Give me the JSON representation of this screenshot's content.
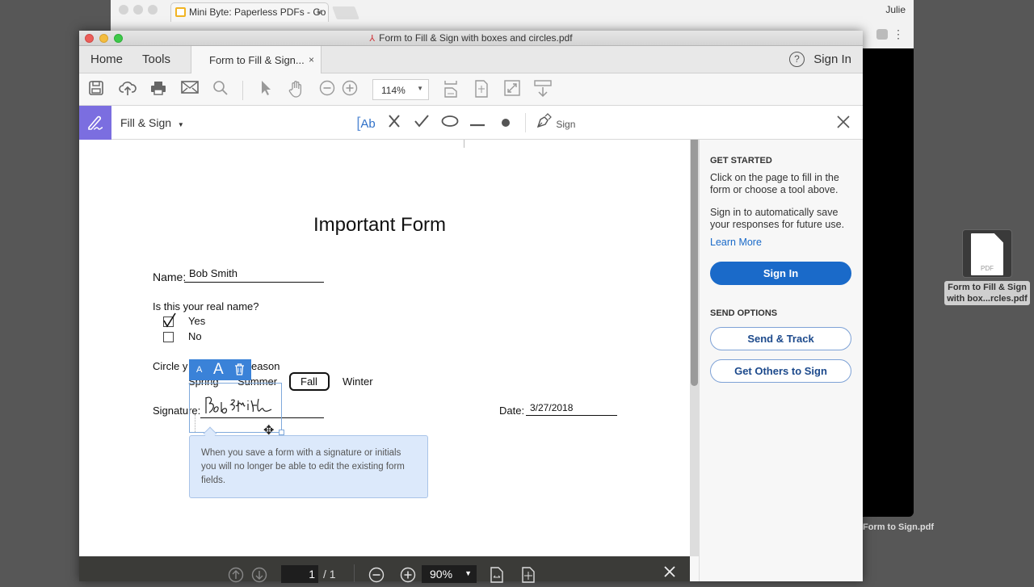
{
  "browser": {
    "tab_title": "Mini Byte: Paperless PDFs - Go",
    "user": "Julie"
  },
  "desktop": {
    "file1_tag": "PDF",
    "file1_label_line1": "Form to Fill & Sign",
    "file1_label_line2": "with box...rcles.pdf",
    "file2_label": "Form to Sign.pdf"
  },
  "window": {
    "title": "Form to Fill & Sign with boxes and circles.pdf",
    "nav": {
      "home": "Home",
      "tools": "Tools"
    },
    "doc_tab": "Form to Fill & Sign...",
    "help": "?",
    "sign_in": "Sign In"
  },
  "toolbar": {
    "zoom": "114%",
    "icons": [
      "save-icon",
      "upload-icon",
      "print-icon",
      "email-icon",
      "search-icon",
      "select-icon",
      "hand-icon",
      "zoom-out-icon",
      "zoom-in-icon",
      "scroll-mode-icon",
      "fit-page-icon",
      "fullscreen-icon",
      "read-mode-icon"
    ]
  },
  "fill_sign": {
    "label": "Fill & Sign",
    "text_tool": "Ab",
    "sign_label": "Sign"
  },
  "form": {
    "title": "Important Form",
    "name_label": "Name:",
    "name_value": "Bob Smith",
    "question": "Is this your real name?",
    "yes_label": "Yes",
    "yes_checked": true,
    "no_label": "No",
    "no_checked": false,
    "season_label": "Circle your favorite season",
    "season_visible_start": "Circle y",
    "season_visible_end": "eason",
    "seasons": [
      "Spring",
      "Summer",
      "Fall",
      "Winter"
    ],
    "selected_season": "Fall",
    "signature_label": "Signature:",
    "signature_value": "BobSmith",
    "date_label": "Date:",
    "date_value": "3/27/2018"
  },
  "signature_toolbar": {
    "small": "A",
    "large": "A"
  },
  "tooltip": "When you save a form with a signature or initials you will no longer be able to edit the existing form fields.",
  "right_panel": {
    "get_started_heading": "GET STARTED",
    "get_started_text": "Click on the page to fill in the form or choose a tool above.",
    "signin_text": "Sign in to automatically save your responses for future use.",
    "learn_more": "Learn More",
    "sign_in_button": "Sign In",
    "send_options_heading": "SEND OPTIONS",
    "send_track_button": "Send & Track",
    "get_others_button": "Get Others to Sign",
    "accent_color": "#1a6ac9"
  },
  "bottom_bar": {
    "page_current": "1",
    "page_total": "/ 1",
    "zoom": "90%"
  }
}
